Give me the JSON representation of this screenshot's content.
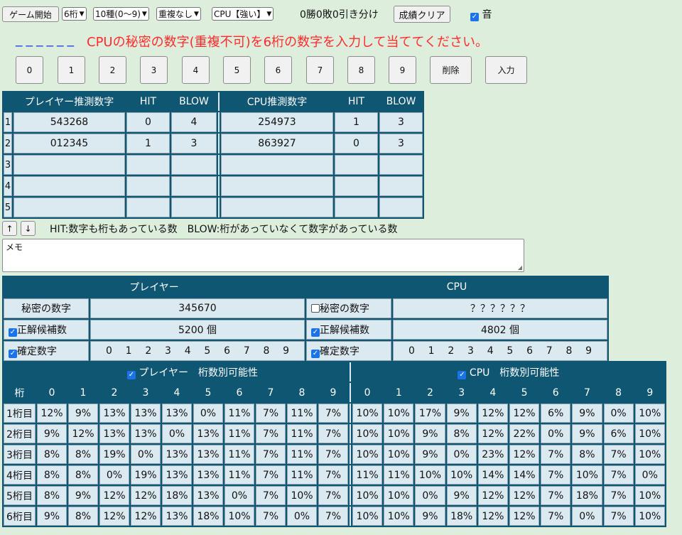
{
  "toolbar": {
    "start_label": "ゲーム開始",
    "digits_select": "6桁",
    "kinds_select": "10種(0～9)",
    "dup_select": "重複なし",
    "cpu_select": "CPU【強い】",
    "score_text": "0勝0敗0引き分け",
    "clear_label": "成績クリア",
    "sound_label": "音"
  },
  "input": {
    "dashes": "______",
    "message": "CPUの秘密の数字(重複不可)を6桁の数字を入力して当ててください。"
  },
  "keypad": {
    "keys": [
      "0",
      "1",
      "2",
      "3",
      "4",
      "5",
      "6",
      "7",
      "8",
      "9"
    ],
    "delete_label": "削除",
    "enter_label": "入力"
  },
  "guess_table": {
    "headers": [
      "プレイヤー推測数字",
      "HIT",
      "BLOW",
      "CPU推測数字",
      "HIT",
      "BLOW"
    ],
    "rows": [
      {
        "no": "1",
        "player": "543268",
        "p_hit": "0",
        "p_blow": "4",
        "cpu": "254973",
        "c_hit": "1",
        "c_blow": "3"
      },
      {
        "no": "2",
        "player": "012345",
        "p_hit": "1",
        "p_blow": "3",
        "cpu": "863927",
        "c_hit": "0",
        "c_blow": "3"
      },
      {
        "no": "3",
        "player": "",
        "p_hit": "",
        "p_blow": "",
        "cpu": "",
        "c_hit": "",
        "c_blow": ""
      },
      {
        "no": "4",
        "player": "",
        "p_hit": "",
        "p_blow": "",
        "cpu": "",
        "c_hit": "",
        "c_blow": ""
      },
      {
        "no": "5",
        "player": "",
        "p_hit": "",
        "p_blow": "",
        "cpu": "",
        "c_hit": "",
        "c_blow": ""
      }
    ]
  },
  "nav": {
    "up": "↑",
    "down": "↓"
  },
  "legend": "HIT:数字も桁もあっている数　BLOW:桁があっていなくて数字があっている数",
  "memo": {
    "value": "メモ"
  },
  "info": {
    "player_header": "プレイヤー",
    "cpu_header": "CPU",
    "secret_label": "秘密の数字",
    "candidates_label": "正解候補数",
    "fixed_label": "確定数字",
    "player_secret": "345670",
    "cpu_secret": "？？？？？？",
    "player_candidates": "5200 個",
    "cpu_candidates": "4802 個",
    "player_fixed": [
      "0",
      "1",
      "2",
      "3",
      "4",
      "5",
      "6",
      "7",
      "8",
      "9"
    ],
    "cpu_fixed": [
      "0",
      "1",
      "2",
      "3",
      "4",
      "5",
      "6",
      "7",
      "8",
      "9"
    ]
  },
  "prob": {
    "player_title": "プレイヤー　桁数別可能性",
    "cpu_title": "CPU　桁数別可能性",
    "digit_header": "桁",
    "columns": [
      "0",
      "1",
      "2",
      "3",
      "4",
      "5",
      "6",
      "7",
      "8",
      "9"
    ],
    "rows": [
      {
        "label": "1桁目",
        "player": [
          "12%",
          "9%",
          "13%",
          "13%",
          "13%",
          "0%",
          "11%",
          "7%",
          "11%",
          "7%"
        ],
        "cpu": [
          "10%",
          "10%",
          "17%",
          "9%",
          "12%",
          "12%",
          "6%",
          "9%",
          "0%",
          "10%"
        ]
      },
      {
        "label": "2桁目",
        "player": [
          "9%",
          "12%",
          "13%",
          "13%",
          "0%",
          "13%",
          "11%",
          "7%",
          "11%",
          "7%"
        ],
        "cpu": [
          "10%",
          "10%",
          "9%",
          "8%",
          "12%",
          "22%",
          "0%",
          "9%",
          "6%",
          "10%"
        ]
      },
      {
        "label": "3桁目",
        "player": [
          "8%",
          "8%",
          "19%",
          "0%",
          "13%",
          "13%",
          "11%",
          "7%",
          "11%",
          "7%"
        ],
        "cpu": [
          "10%",
          "10%",
          "9%",
          "0%",
          "23%",
          "12%",
          "7%",
          "8%",
          "7%",
          "10%"
        ]
      },
      {
        "label": "4桁目",
        "player": [
          "8%",
          "8%",
          "0%",
          "19%",
          "13%",
          "13%",
          "11%",
          "7%",
          "11%",
          "7%"
        ],
        "cpu": [
          "11%",
          "11%",
          "10%",
          "10%",
          "14%",
          "14%",
          "7%",
          "10%",
          "7%",
          "0%"
        ]
      },
      {
        "label": "5桁目",
        "player": [
          "8%",
          "9%",
          "12%",
          "12%",
          "18%",
          "13%",
          "0%",
          "7%",
          "10%",
          "7%"
        ],
        "cpu": [
          "10%",
          "10%",
          "0%",
          "9%",
          "12%",
          "12%",
          "7%",
          "18%",
          "7%",
          "10%"
        ]
      },
      {
        "label": "6桁目",
        "player": [
          "9%",
          "8%",
          "12%",
          "12%",
          "13%",
          "18%",
          "10%",
          "7%",
          "0%",
          "7%"
        ],
        "cpu": [
          "10%",
          "10%",
          "9%",
          "18%",
          "12%",
          "12%",
          "7%",
          "0%",
          "7%",
          "10%"
        ]
      }
    ]
  },
  "colors": {
    "background": "#deeedd",
    "table_header": "#0f5673",
    "cell": "#dbe9f0",
    "message": "#ff2b2b",
    "dashes": "#1c36e8"
  }
}
